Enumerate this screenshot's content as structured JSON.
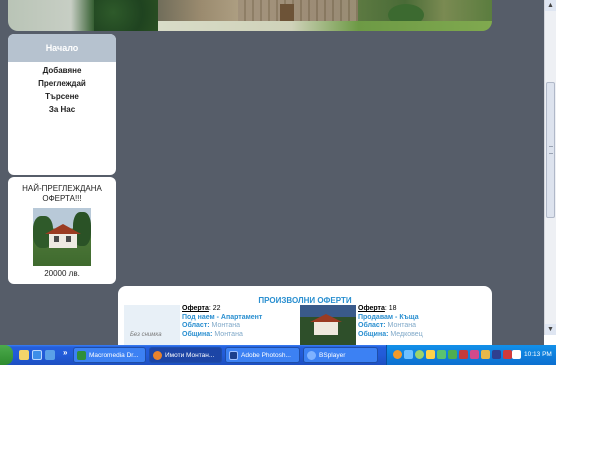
{
  "menu": {
    "active": "Начало",
    "items": [
      "Добавяне",
      "Преглеждай",
      "Търсене",
      "За Нас"
    ]
  },
  "popular": {
    "title": "НАЙ-ПРЕГЛЕЖДАНА ОФЕРТА!!!",
    "price": "20000 лв."
  },
  "offers": {
    "heading": "ПРОИЗВОЛНИ ОФЕРТИ",
    "list": [
      {
        "offer_label": "Оферта",
        "offer_no": "22",
        "type": "Под наем - Апартамент",
        "region_label": "Област:",
        "region": "Монтана",
        "municipality_label": "Община:",
        "municipality": "Монтана",
        "image_caption": "Без снимка"
      },
      {
        "offer_label": "Оферта",
        "offer_no": "18",
        "type": "Продавам - Къща",
        "region_label": "Област:",
        "region": "Монтана",
        "municipality_label": "Община:",
        "municipality": "Медковец"
      }
    ]
  },
  "scrollbar": {
    "up_arrow": "▲",
    "down_arrow": "▼"
  },
  "taskbar": {
    "quick_launch_more": "»",
    "tasks": [
      {
        "label": "Macromedia Dr...",
        "icon": "dreamweaver-icon",
        "active": false
      },
      {
        "label": "Имоти Монтан...",
        "icon": "firefox-icon",
        "active": true
      },
      {
        "label": "Adobe Photosh...",
        "icon": "photoshop-icon",
        "active": false
      },
      {
        "label": "BSplayer",
        "icon": "bsplayer-icon",
        "active": false
      }
    ],
    "clock": "10:13 PM"
  },
  "colors": {
    "page_background": "#565d69",
    "menu_active": "#b6c2cf",
    "offers_heading": "#2a8fd0",
    "taskbar": "#245edc",
    "tray": "#0c6fd0"
  }
}
